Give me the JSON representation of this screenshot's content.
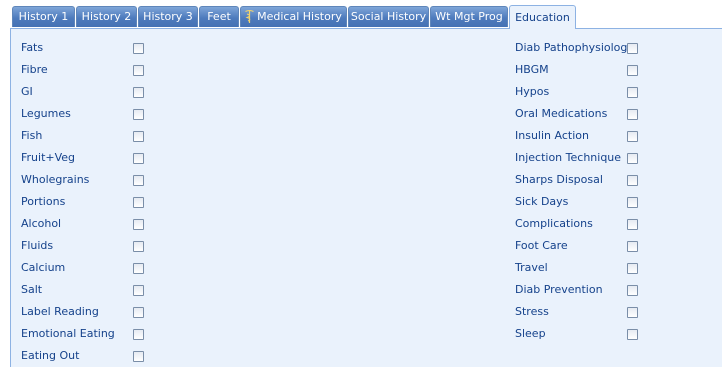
{
  "tabs": [
    {
      "label": "History 1",
      "active": false
    },
    {
      "label": "History 2",
      "active": false
    },
    {
      "label": "History 3",
      "active": false
    },
    {
      "label": "Feet",
      "active": false
    },
    {
      "label": "Medical History",
      "active": false,
      "icon": "caduceus-icon"
    },
    {
      "label": "Social History",
      "active": false
    },
    {
      "label": "Wt Mgt Prog",
      "active": false
    },
    {
      "label": "Education",
      "active": true
    }
  ],
  "education": {
    "left_items": [
      {
        "label": "Fats",
        "checked": false
      },
      {
        "label": "Fibre",
        "checked": false
      },
      {
        "label": "GI",
        "checked": false
      },
      {
        "label": "Legumes",
        "checked": false
      },
      {
        "label": "Fish",
        "checked": false
      },
      {
        "label": "Fruit+Veg",
        "checked": false
      },
      {
        "label": "Wholegrains",
        "checked": false
      },
      {
        "label": "Portions",
        "checked": false
      },
      {
        "label": "Alcohol",
        "checked": false
      },
      {
        "label": "Fluids",
        "checked": false
      },
      {
        "label": "Calcium",
        "checked": false
      },
      {
        "label": "Salt",
        "checked": false
      },
      {
        "label": "Label Reading",
        "checked": false
      },
      {
        "label": "Emotional Eating",
        "checked": false
      },
      {
        "label": "Eating Out",
        "checked": false
      }
    ],
    "right_items": [
      {
        "label": "Diab Pathophysiology",
        "checked": false
      },
      {
        "label": "HBGM",
        "checked": false
      },
      {
        "label": "Hypos",
        "checked": false
      },
      {
        "label": "Oral Medications",
        "checked": false
      },
      {
        "label": "Insulin Action",
        "checked": false
      },
      {
        "label": "Injection Technique",
        "checked": false
      },
      {
        "label": "Sharps Disposal",
        "checked": false
      },
      {
        "label": "Sick Days",
        "checked": false
      },
      {
        "label": "Complications",
        "checked": false
      },
      {
        "label": "Foot Care",
        "checked": false
      },
      {
        "label": "Travel",
        "checked": false
      },
      {
        "label": "Diab Prevention",
        "checked": false
      },
      {
        "label": "Stress",
        "checked": false
      },
      {
        "label": "Sleep",
        "checked": false
      }
    ]
  },
  "colors": {
    "panel_bg": "#eaf2fc",
    "tab_bg": "#4e7bbd",
    "label_text": "#15428b"
  }
}
